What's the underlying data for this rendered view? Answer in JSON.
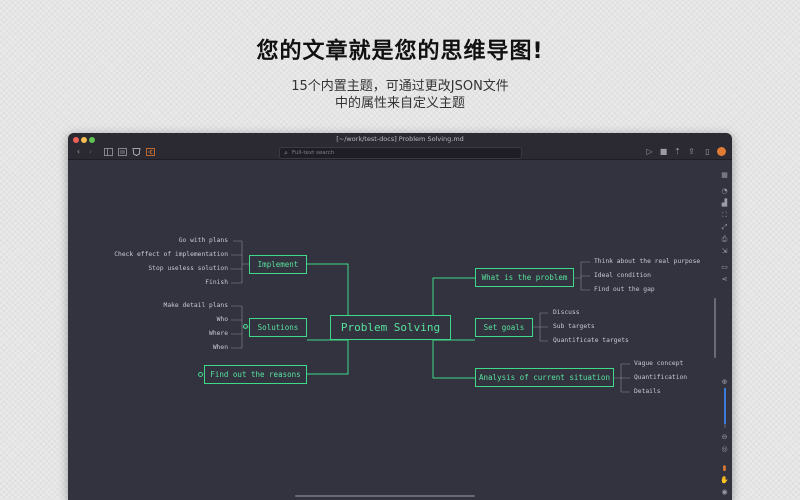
{
  "promo": {
    "headline": "您的文章就是您的思维导图!",
    "sub1": "15个内置主题，可通过更改JSON文件",
    "sub2": "中的属性来自定义主题"
  },
  "window": {
    "title": "[~/work/test-docs] Problem Solving.md",
    "search_placeholder": "Full-text search",
    "avatar_initial": "●"
  },
  "mindmap": {
    "root": "Problem Solving",
    "left_branches": [
      {
        "label": "Implement",
        "children": [
          "Go with plans",
          "Check effect of implementation",
          "Stop useless solution",
          "Finish"
        ]
      },
      {
        "label": "Solutions",
        "children": [
          "Make detail plans",
          "Who",
          "Where",
          "When"
        ]
      },
      {
        "label": "Find out the reasons",
        "children": []
      }
    ],
    "right_branches": [
      {
        "label": "What is the problem",
        "children": [
          "Think about the real purpose",
          "Ideal condition",
          "Find out the gap"
        ]
      },
      {
        "label": "Set goals",
        "children": [
          "Discuss",
          "Sub targets",
          "Quantificate targets"
        ]
      },
      {
        "label": "Analysis of current situation",
        "children": [
          "Vague concept",
          "Quantification",
          "Details"
        ]
      }
    ]
  },
  "colors": {
    "accent": "#3fd98a",
    "canvas_bg": "#33323f",
    "leaf_text": "#c9c9d2"
  }
}
